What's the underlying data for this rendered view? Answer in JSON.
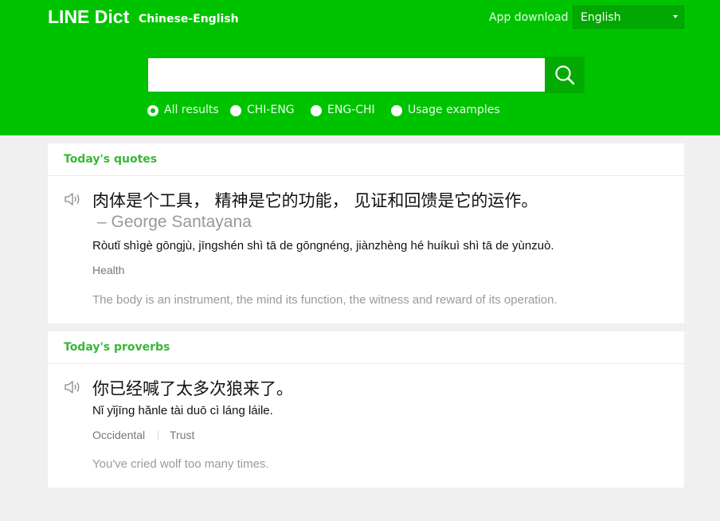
{
  "header": {
    "logo": "LINE Dict",
    "logo_sub": "Chinese-English",
    "app_download": "App download",
    "language": "English"
  },
  "search": {
    "value": "",
    "placeholder": ""
  },
  "filters": [
    {
      "label": "All results",
      "checked": true
    },
    {
      "label": "CHI-ENG",
      "checked": false
    },
    {
      "label": "ENG-CHI",
      "checked": false
    },
    {
      "label": "Usage examples",
      "checked": false
    }
  ],
  "quotes": {
    "title": "Today's quotes",
    "chinese": "肉体是个工具， 精神是它的功能， 见证和回馈是它的运作。",
    "author": "– George Santayana",
    "pinyin": "Ròutǐ shìgè gōngjù, jīngshén shì tā de gōngnéng, jiànzhèng hé huíkuì shì tā de yùnzuò.",
    "tags": [
      "Health"
    ],
    "translation": "The body is an instrument, the mind its function, the witness and reward of its operation."
  },
  "proverbs": {
    "title": "Today's proverbs",
    "chinese": "你已经喊了太多次狼来了。",
    "pinyin": "Nǐ yǐjīng hǎnle tài duō cì láng láile.",
    "tags": [
      "Occidental",
      "Trust"
    ],
    "translation": "You've cried wolf too many times."
  },
  "colors": {
    "brand_green": "#00c300",
    "dark_green": "#03aa03",
    "title_green": "#39b639"
  },
  "icons": {
    "search": "magnifier-icon",
    "speaker": "speaker-icon",
    "caret": "chevron-down-icon"
  }
}
